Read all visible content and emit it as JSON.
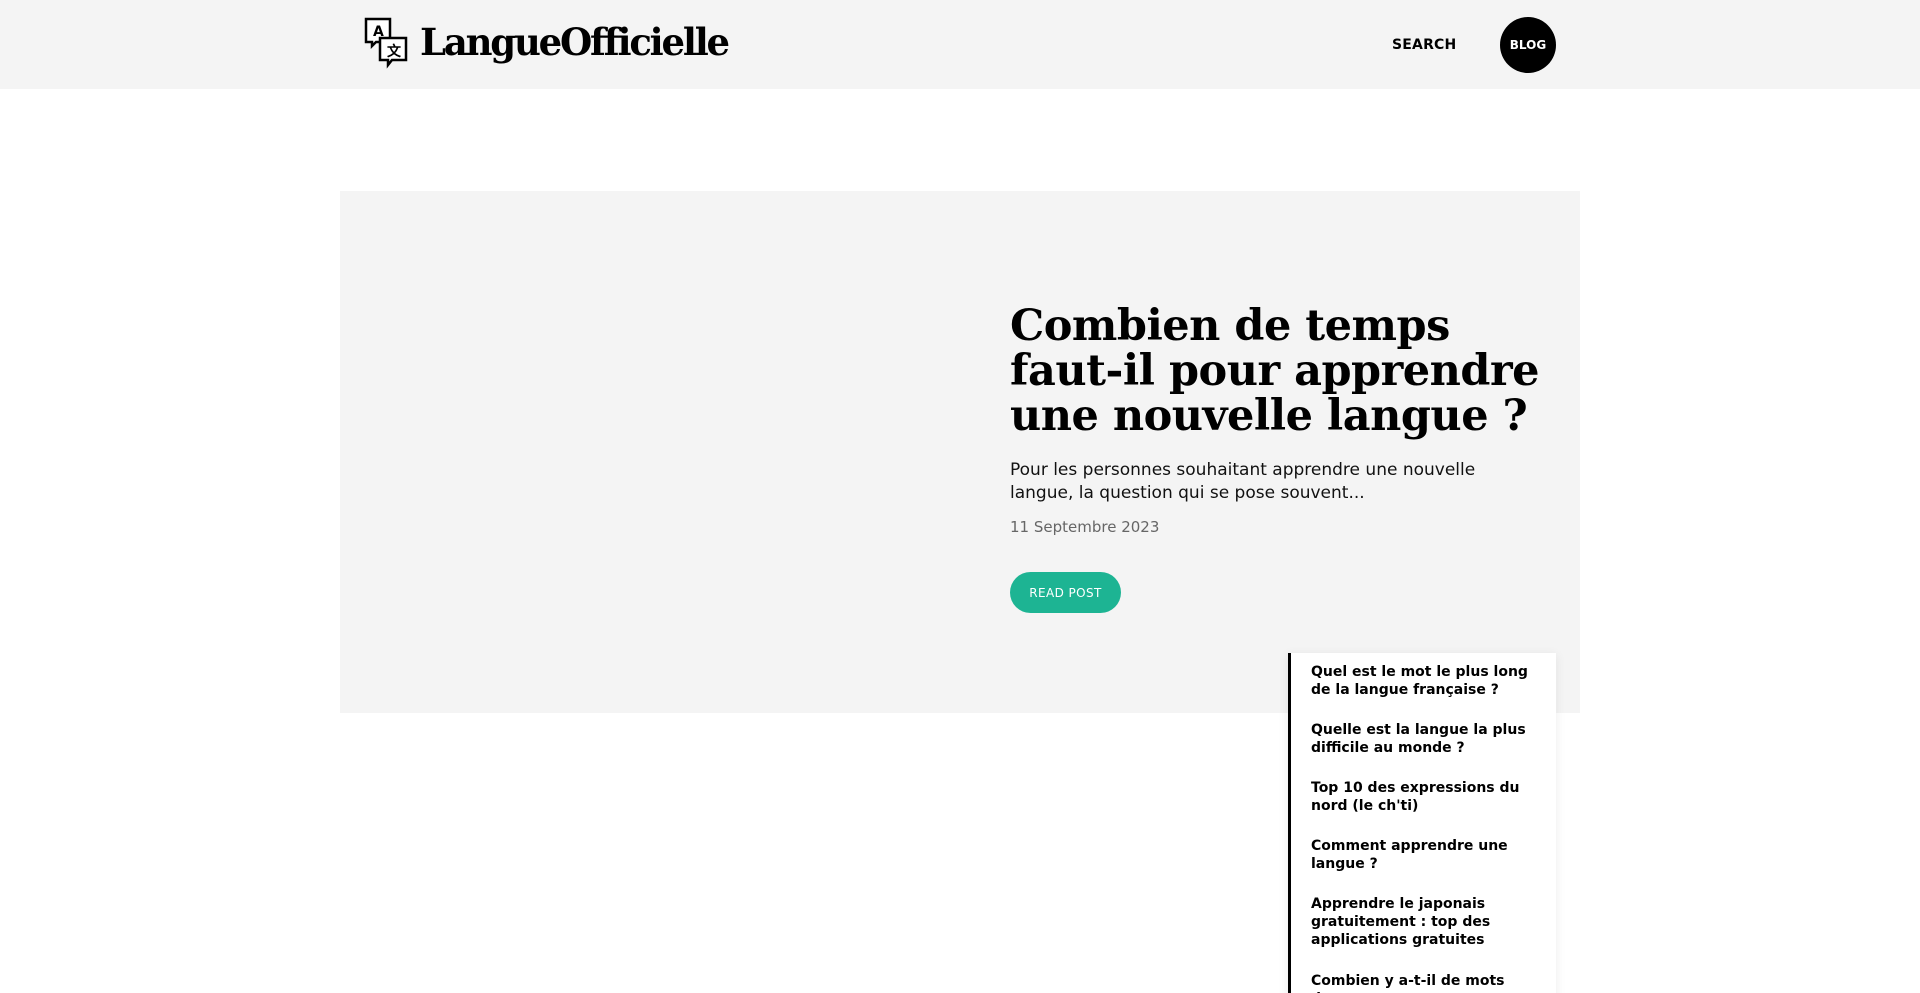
{
  "header": {
    "logo_text": "LangueOfficielle",
    "logo_icon_letters": [
      "A",
      "文"
    ],
    "nav": {
      "search_label": "SEARCH",
      "blog_label": "BLOG"
    }
  },
  "hero": {
    "title": "Combien de temps faut-il pour apprendre une nouvelle langue ?",
    "excerpt": "Pour les personnes souhaitant apprendre une nouvelle langue, la question qui se pose souvent...",
    "date": "11 Septembre 2023",
    "read_button_label": "READ POST"
  },
  "related_posts": [
    {
      "title": "Quel est le mot le plus long de la langue française ?"
    },
    {
      "title": "Quelle est la langue la plus difficile au monde ?"
    },
    {
      "title": "Top 10 des expressions du nord (le ch'ti)"
    },
    {
      "title": "Comment apprendre une langue ?"
    },
    {
      "title": "Apprendre le japonais gratuitement : top des applications gratuites"
    },
    {
      "title": "Combien y a-t-il de mots dans"
    }
  ],
  "colors": {
    "accent": "#1db493",
    "header_bg": "#f4f4f4",
    "hero_bg": "#f4f4f4",
    "text": "#000000",
    "date": "#666666"
  }
}
